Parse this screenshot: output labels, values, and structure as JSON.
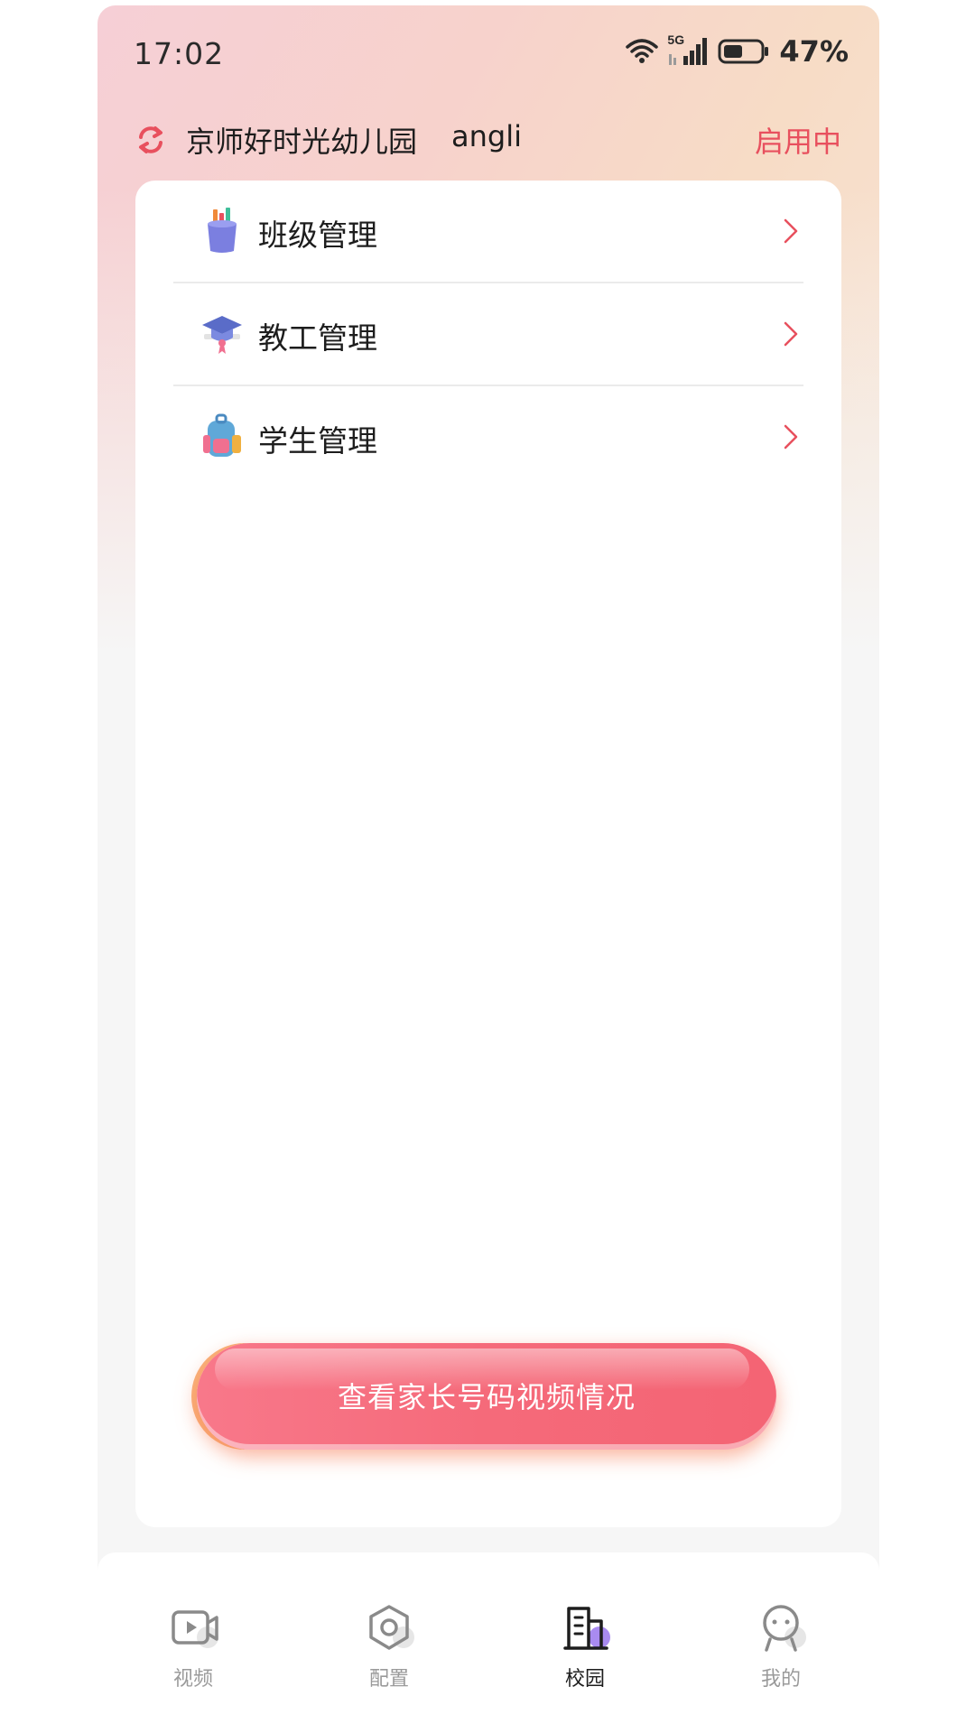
{
  "status_bar": {
    "time": "17:02",
    "network": "5G",
    "battery": "47%"
  },
  "header": {
    "school_name": "京师好时光幼儿园",
    "user_name": "angli",
    "status": "启用中"
  },
  "menu": {
    "items": [
      {
        "label": "班级管理",
        "icon": "pencil-cup-icon"
      },
      {
        "label": "教工管理",
        "icon": "graduation-cap-icon"
      },
      {
        "label": "学生管理",
        "icon": "backpack-icon"
      }
    ]
  },
  "main_button": {
    "label": "查看家长号码视频情况"
  },
  "bottom_nav": {
    "items": [
      {
        "label": "视频",
        "icon": "video-icon",
        "active": false
      },
      {
        "label": "配置",
        "icon": "hexagon-settings-icon",
        "active": false
      },
      {
        "label": "校园",
        "icon": "campus-building-icon",
        "active": true
      },
      {
        "label": "我的",
        "icon": "profile-icon",
        "active": false
      }
    ]
  },
  "colors": {
    "accent": "#e8505e",
    "active_dot": "#a98bf0",
    "button": "#f56a7a"
  }
}
